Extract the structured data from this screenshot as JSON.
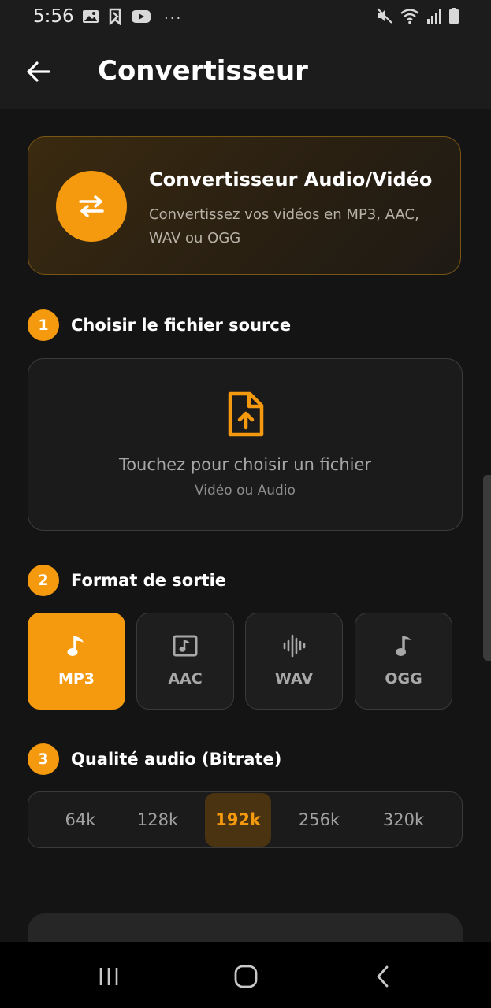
{
  "status_bar": {
    "time": "5:56",
    "more": "···"
  },
  "app_bar": {
    "title": "Convertisseur"
  },
  "hero": {
    "title": "Convertisseur Audio/Vidéo",
    "subtitle": "Convertissez vos vidéos en MP3, AAC, WAV ou OGG"
  },
  "steps": [
    {
      "number": "1",
      "label": "Choisir le fichier source"
    },
    {
      "number": "2",
      "label": "Format de sortie"
    },
    {
      "number": "3",
      "label": "Qualité audio (Bitrate)"
    }
  ],
  "file_picker": {
    "title": "Touchez pour choisir un fichier",
    "hint": "Vidéo ou Audio"
  },
  "formats": [
    {
      "label": "MP3",
      "icon": "music-note-icon",
      "selected": true
    },
    {
      "label": "AAC",
      "icon": "music-file-icon",
      "selected": false
    },
    {
      "label": "WAV",
      "icon": "waveform-icon",
      "selected": false
    },
    {
      "label": "OGG",
      "icon": "music-note-icon",
      "selected": false
    }
  ],
  "bitrates": {
    "options": [
      "64k",
      "128k",
      "192k",
      "256k",
      "320k"
    ],
    "selected": "192k"
  },
  "colors": {
    "accent": "#f59a0f",
    "background": "#141414",
    "surface": "#1b1b1b"
  }
}
